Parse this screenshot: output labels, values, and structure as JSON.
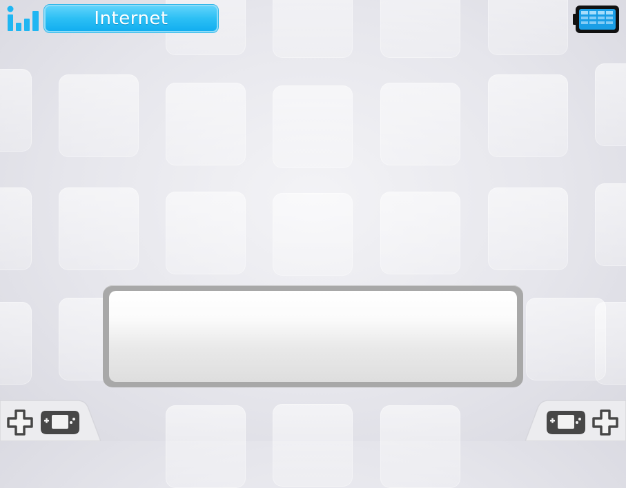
{
  "status_bar": {
    "connection_label": "Internet",
    "signal_icon": "wifi-signal-bars-icon",
    "battery_icon": "battery-full-icon"
  },
  "dialog": {
    "message": ""
  },
  "bottom_bar": {
    "left_icons": [
      "dpad-icon",
      "handheld-console-icon"
    ],
    "right_icons": [
      "handheld-console-icon",
      "dpad-icon"
    ]
  },
  "colors": {
    "accent_blue": "#1fb6f2",
    "icon_gray": "#4a4a4a",
    "frame_gray": "#a8a8a8"
  }
}
